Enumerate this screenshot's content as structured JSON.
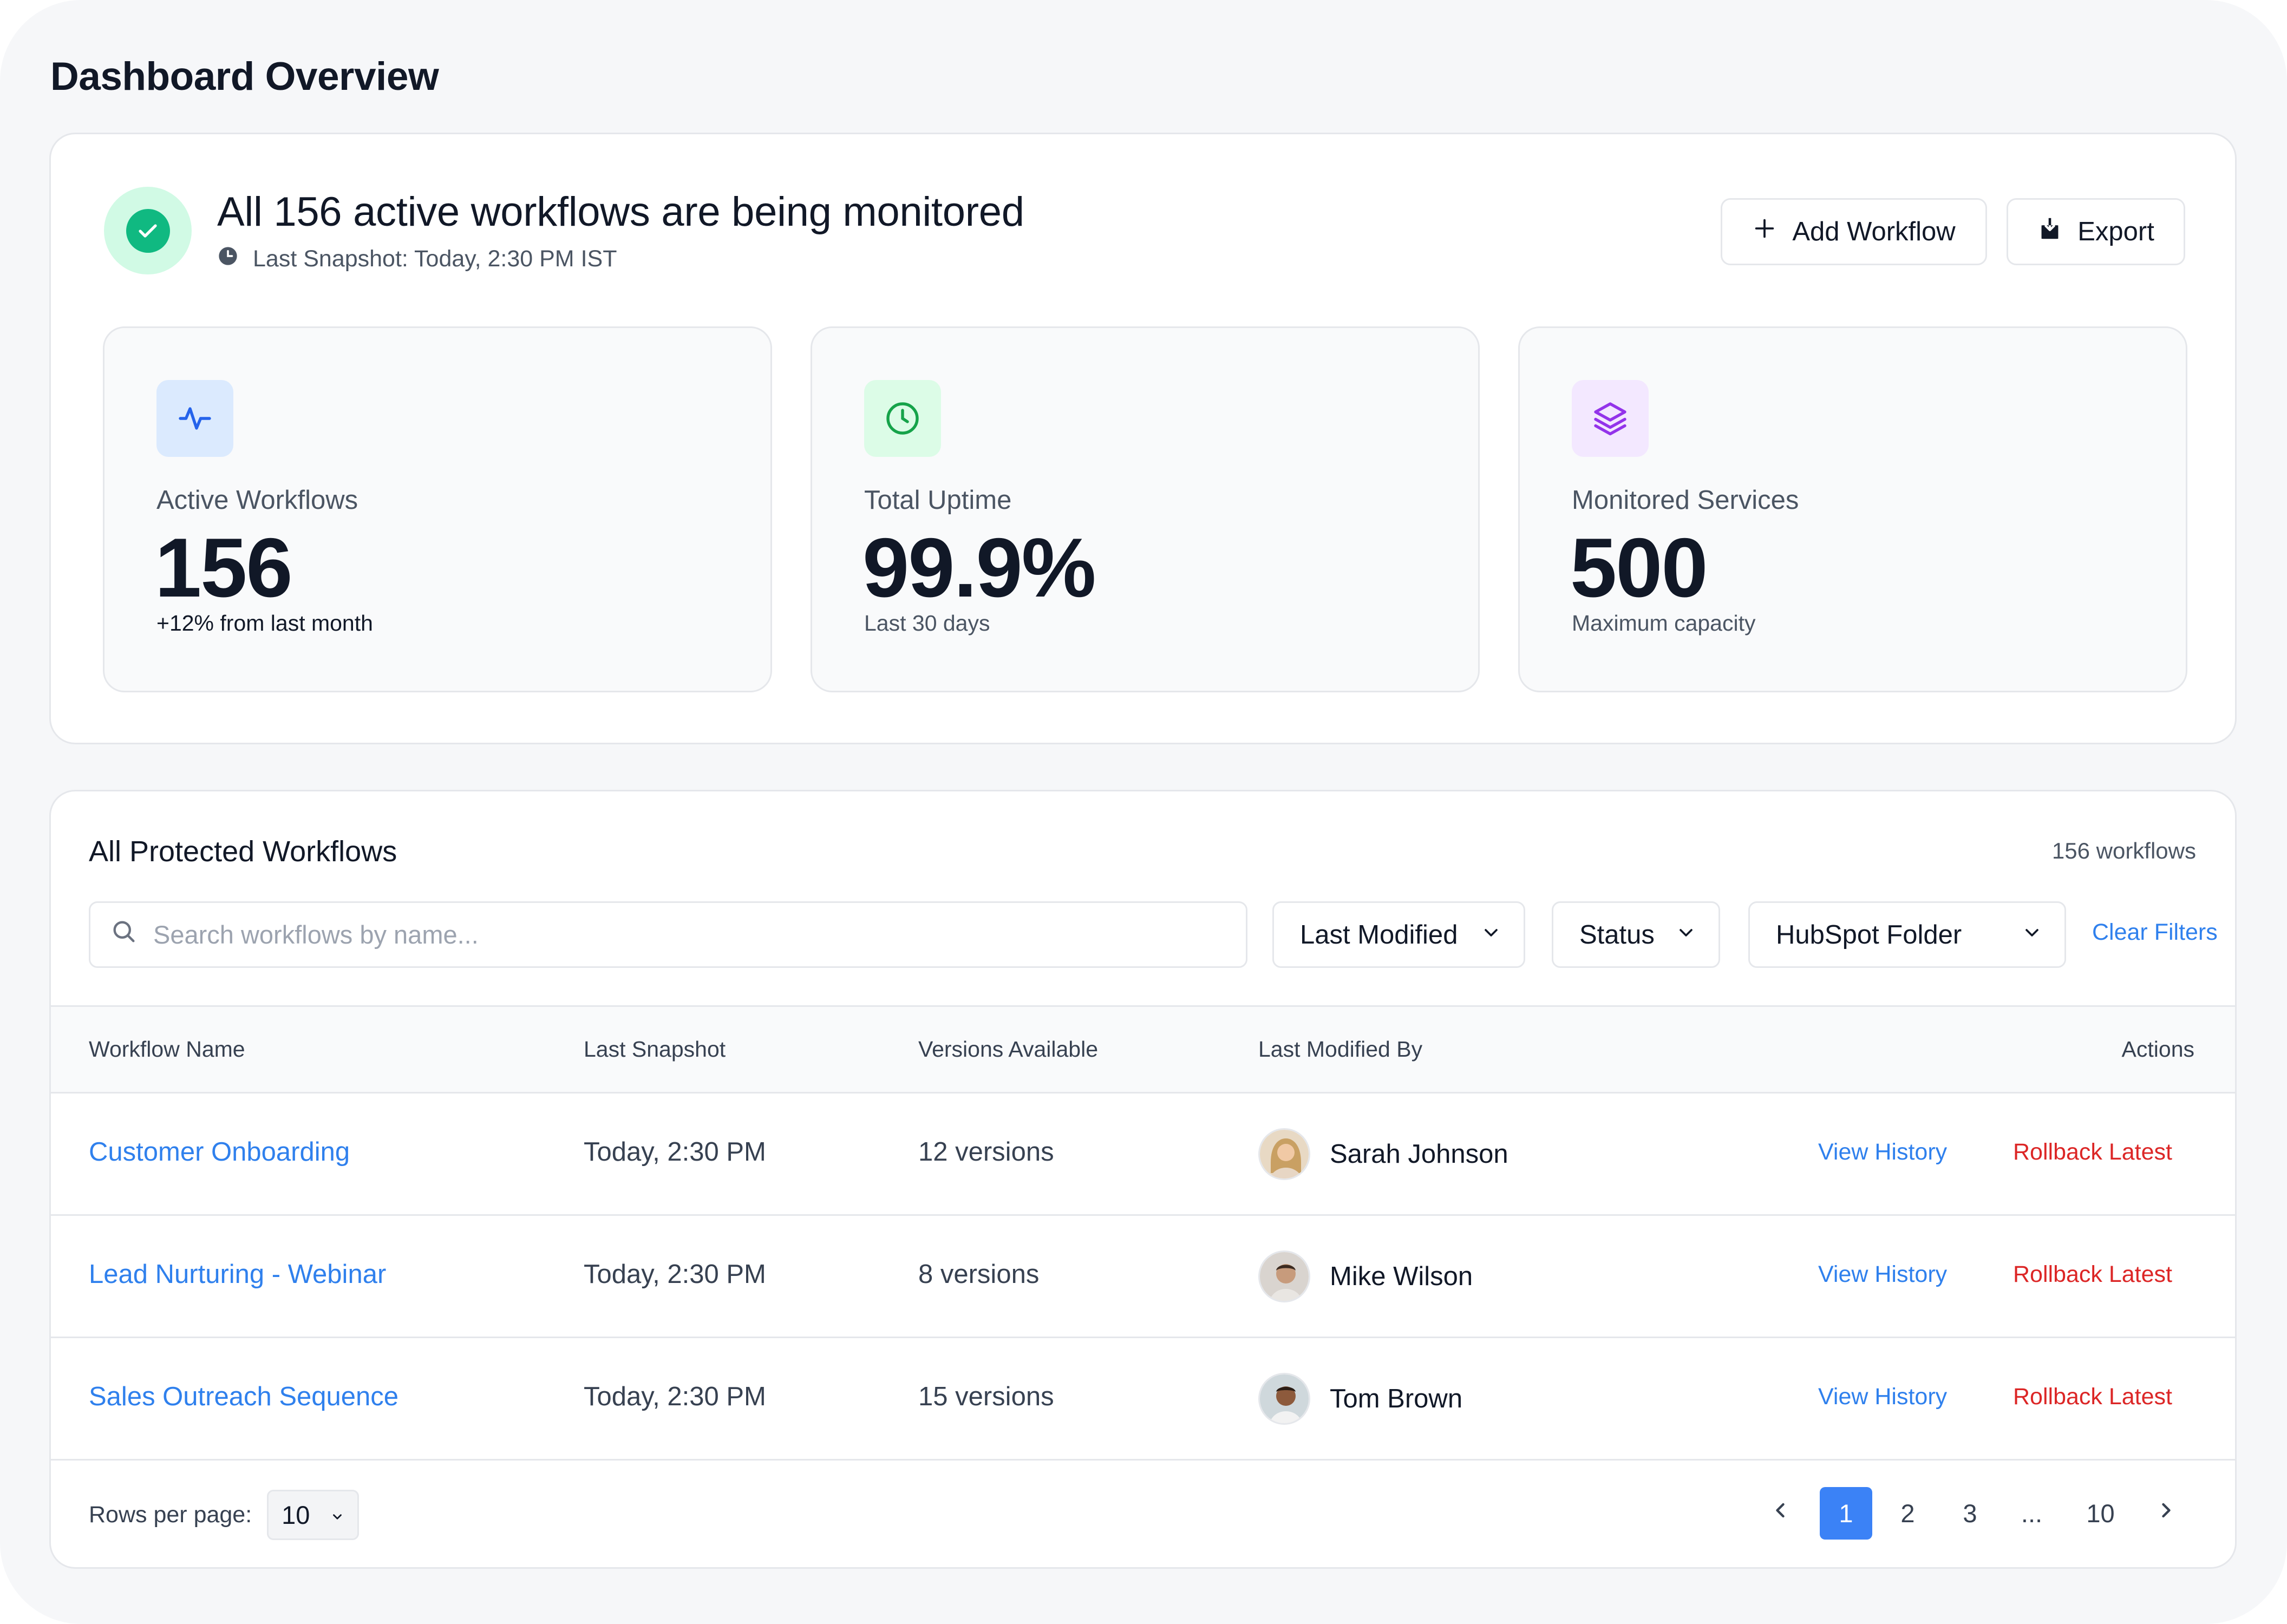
{
  "page": {
    "title": "Dashboard Overview"
  },
  "summary": {
    "headline": "All 156 active workflows are being monitored",
    "snapshot": "Last Snapshot: Today, 2:30 PM IST",
    "add_label": "Add Workflow",
    "export_label": "Export"
  },
  "stats": [
    {
      "label": "Active Workflows",
      "value": "156",
      "sub": "+12% from last month",
      "icon": "activity-icon",
      "icon_bg": "#dbeafe",
      "icon_color": "#2563eb",
      "sub_color": "#111827"
    },
    {
      "label": "Total Uptime",
      "value": "99.9%",
      "sub": "Last 30 days",
      "icon": "clock-icon",
      "icon_bg": "#dcfce7",
      "icon_color": "#16a34a",
      "sub_color": "#4b5563"
    },
    {
      "label": "Monitored Services",
      "value": "500",
      "sub": "Maximum capacity",
      "icon": "layers-icon",
      "icon_bg": "#f3e8ff",
      "icon_color": "#9333ea",
      "sub_color": "#4b5563"
    }
  ],
  "table": {
    "title": "All Protected Workflows",
    "count": "156 workflows",
    "search_placeholder": "Search workflows by name...",
    "filters": [
      "Last Modified",
      "Status",
      "HubSpot Folder"
    ],
    "clear_filters": "Clear Filters",
    "columns": [
      "Workflow Name",
      "Last Snapshot",
      "Versions Available",
      "Last Modified By",
      "Actions"
    ],
    "rows": [
      {
        "name": "Customer Onboarding",
        "snapshot": "Today, 2:30 PM",
        "versions": "12 versions",
        "user": "Sarah Johnson",
        "view": "View History",
        "rollback": "Rollback Latest"
      },
      {
        "name": "Lead Nurturing - Webinar",
        "snapshot": "Today, 2:30 PM",
        "versions": "8 versions",
        "user": "Mike Wilson",
        "view": "View History",
        "rollback": "Rollback Latest"
      },
      {
        "name": "Sales Outreach Sequence",
        "snapshot": "Today, 2:30 PM",
        "versions": "15 versions",
        "user": "Tom Brown",
        "view": "View History",
        "rollback": "Rollback Latest"
      }
    ],
    "rows_per_page_label": "Rows per page:",
    "rows_per_page": "10",
    "pages": [
      "1",
      "2",
      "3",
      "...",
      "10"
    ],
    "current_page": "1"
  },
  "colors": {
    "accent": "#2f80ed",
    "danger": "#dc2626",
    "success": "#10b981",
    "pager_active": "#3b82f6"
  }
}
